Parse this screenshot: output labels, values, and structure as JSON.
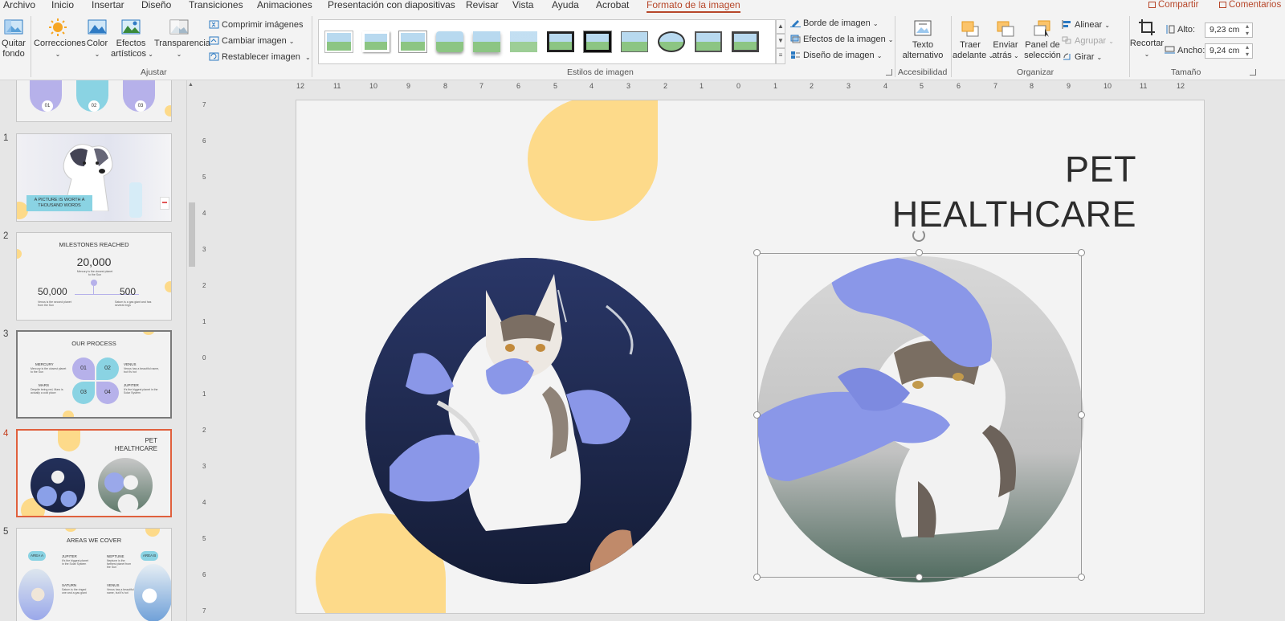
{
  "tabs": [
    {
      "label": "Archivo"
    },
    {
      "label": "Inicio"
    },
    {
      "label": "Insertar"
    },
    {
      "label": "Diseño"
    },
    {
      "label": "Transiciones"
    },
    {
      "label": "Animaciones"
    },
    {
      "label": "Presentación con diapositivas"
    },
    {
      "label": "Revisar"
    },
    {
      "label": "Vista"
    },
    {
      "label": "Ayuda"
    },
    {
      "label": "Acrobat"
    },
    {
      "label": "Formato de la imagen"
    }
  ],
  "header": {
    "share": "Compartir",
    "comments": "Comentarios"
  },
  "ribbon": {
    "ajustar": {
      "quitar_fondo_1": "Quitar",
      "quitar_fondo_2": "fondo",
      "correcciones": "Correcciones",
      "color": "Color",
      "efectos_1": "Efectos",
      "efectos_2": "artísticos",
      "transparencia": "Transparencia",
      "comprimir": "Comprimir imágenes",
      "cambiar": "Cambiar imagen",
      "restablecer": "Restablecer imagen",
      "group_label": "Ajustar"
    },
    "estilos": {
      "borde": "Borde de imagen",
      "efectos": "Efectos de la imagen",
      "diseno": "Diseño de imagen",
      "group_label": "Estilos de imagen"
    },
    "accesibilidad": {
      "texto_1": "Texto",
      "texto_2": "alternativo",
      "group_label": "Accesibilidad"
    },
    "organizar": {
      "traer_1": "Traer",
      "traer_2": "adelante",
      "enviar_1": "Enviar",
      "enviar_2": "atrás",
      "panel_1": "Panel de",
      "panel_2": "selección",
      "alinear": "Alinear",
      "agrupar": "Agrupar",
      "girar": "Girar",
      "group_label": "Organizar"
    },
    "tamano": {
      "recortar": "Recortar",
      "alto_label": "Alto:",
      "alto_value": "9,23 cm",
      "ancho_label": "Ancho:",
      "ancho_value": "9,24 cm",
      "group_label": "Tamaño"
    }
  },
  "slides_pane": {
    "partial": {
      "labels": [
        "01",
        "02",
        "03"
      ]
    },
    "s1": {
      "num": "1",
      "banner": "A PICTURE IS WORTH A THOUSAND WORDS"
    },
    "s2": {
      "num": "2",
      "title": "MILESTONES REACHED",
      "big": "20,000",
      "left": "50,000",
      "right": "500"
    },
    "s3": {
      "num": "3",
      "title": "OUR PROCESS",
      "n1": "01",
      "n2": "02",
      "n3": "03",
      "n4": "04",
      "mercury": "MERCURY",
      "venus": "VENUS",
      "mars": "MARS",
      "jupiter": "JUPITER"
    },
    "s4": {
      "num": "4",
      "title": "PET HEALTHCARE"
    },
    "s5": {
      "num": "5",
      "title": "AREAS WE COVER",
      "area_a": "AREA A",
      "area_b": "AREA B",
      "jupiter": "JUPITER",
      "neptune": "NEPTUNE",
      "saturn": "SATURN",
      "venus": "VENUS"
    }
  },
  "ruler": {
    "h": [
      "12",
      "11",
      "10",
      "9",
      "8",
      "7",
      "6",
      "5",
      "4",
      "3",
      "2",
      "1",
      "0",
      "1",
      "2",
      "3",
      "4",
      "5",
      "6",
      "7",
      "8",
      "9",
      "10",
      "11",
      "12"
    ],
    "v": [
      "7",
      "6",
      "5",
      "4",
      "3",
      "2",
      "1",
      "0",
      "1",
      "2",
      "3",
      "4",
      "5",
      "6",
      "7"
    ]
  },
  "slide": {
    "title_line1": "PET",
    "title_line2": "HEALTHCARE"
  },
  "colors": {
    "accent": "#b7472a",
    "blob": "#fdda8a",
    "selected_thumb_border": "#e0603d"
  }
}
